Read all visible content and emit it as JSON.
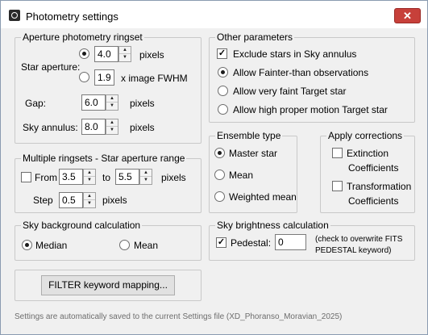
{
  "window": {
    "title": "Photometry settings",
    "app_icon": "photometry-app-icon",
    "close_icon": "close-icon",
    "close_glyph": "✕"
  },
  "aperture": {
    "legend": "Aperture photometry ringset",
    "star_aperture_label": "Star aperture:",
    "radio_pixels_selected": true,
    "pixels_value": "4.0",
    "pixels_unit": "pixels",
    "fwhm_value": "1.9",
    "fwhm_unit": "x image FWHM",
    "gap_label": "Gap:",
    "gap_value": "6.0",
    "gap_unit": "pixels",
    "sky_label": "Sky annulus:",
    "sky_value": "8.0",
    "sky_unit": "pixels"
  },
  "other": {
    "legend": "Other parameters",
    "exclude_label": "Exclude stars in Sky annulus",
    "exclude_checked": true,
    "options": [
      {
        "label": "Allow Fainter-than observations",
        "selected": true
      },
      {
        "label": "Allow very faint Target star",
        "selected": false
      },
      {
        "label": "Allow high proper motion Target star",
        "selected": false
      }
    ]
  },
  "multiple": {
    "legend": "Multiple ringsets - Star aperture range",
    "from_label": "From",
    "from_checked": false,
    "from_value": "3.5",
    "to_label": "to",
    "to_value": "5.5",
    "unit": "pixels",
    "step_label": "Step",
    "step_value": "0.5",
    "step_unit": "pixels"
  },
  "ensemble": {
    "legend": "Ensemble type",
    "options": [
      {
        "label": "Master star",
        "selected": true
      },
      {
        "label": "Mean",
        "selected": false
      },
      {
        "label": "Weighted mean",
        "selected": false
      }
    ]
  },
  "corrections": {
    "legend": "Apply corrections",
    "extinction_line1": "Extinction",
    "extinction_line2": "Coefficients",
    "extinction_checked": false,
    "transformation_line1": "Transformation",
    "transformation_line2": "Coefficients",
    "transformation_checked": false
  },
  "sky_bg": {
    "legend": "Sky background calculation",
    "median_label": "Median",
    "median_selected": true,
    "mean_label": "Mean",
    "mean_selected": false
  },
  "sky_brightness": {
    "legend": "Sky brightness calculation",
    "pedestal_label": "Pedestal:",
    "pedestal_checked": true,
    "pedestal_value": "0",
    "note_line1": "(check to overwrite FITS",
    "note_line2": "PEDESTAL keyword)"
  },
  "filter_button_label": "FILTER keyword mapping...",
  "footer": "Settings are automatically saved to the current Settings file (XD_Phoranso_Moravian_2025)",
  "check_glyph": "✓",
  "spin_up_glyph": "▲",
  "spin_down_glyph": "▼"
}
